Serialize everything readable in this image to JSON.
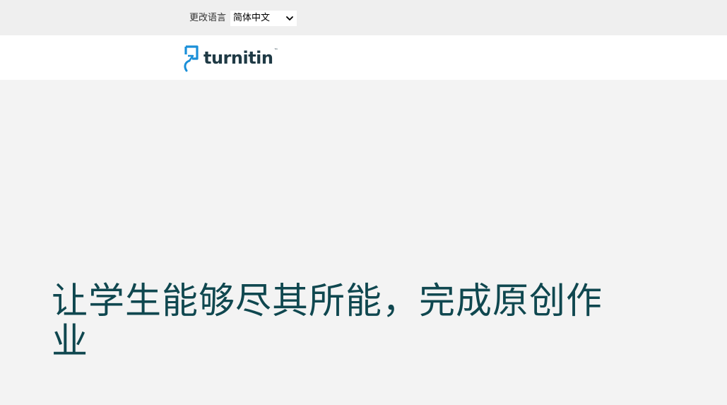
{
  "language_bar": {
    "label": "更改语言",
    "selected_language": "简体中文"
  },
  "header": {
    "logo_text": "turnitin",
    "logo_tm": "™"
  },
  "hero": {
    "title": "让学生能够尽其所能，完成原创作业"
  },
  "colors": {
    "brand_blue": "#1a8fd8",
    "heading_teal": "#0f474f",
    "logo_text": "#1f3a45"
  },
  "icons": {
    "logo_mark": "turnitin-logo-icon",
    "dropdown": "chevron-down-icon"
  }
}
